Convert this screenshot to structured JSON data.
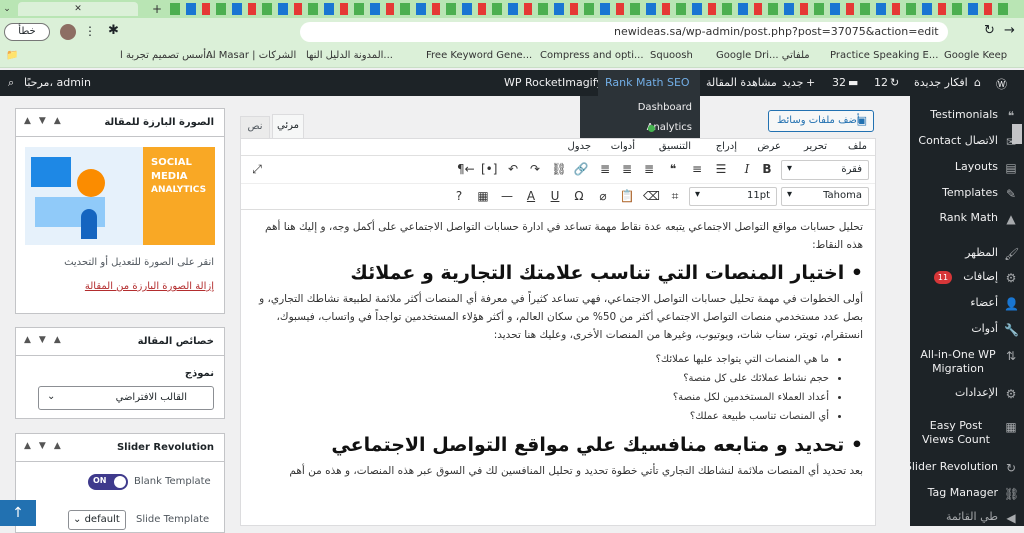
{
  "browser": {
    "url": "newideas.sa/wp-admin/post.php?post=37075&action=edit",
    "error_badge": "خطأ",
    "bookmarks": [
      "أسس تصميم تجربة ا...",
      "Al Masar | الشركات",
      "المدونة الدليل النها...",
      "Free Keyword Gene...",
      "Compress and opti...",
      "Squoosh",
      "Google Dri... ملفاتي",
      "Practice Speaking E...",
      "Google Keep"
    ]
  },
  "adminbar": {
    "greeting": "مرحبًا، admin",
    "wp_rocket": "WP Rocket",
    "imagify": "Imagify",
    "rank_math_seo": "Rank Math SEO",
    "view_post": "مشاهدة المقالة",
    "new": "جديد",
    "comments_count": "32",
    "updates_count": "12",
    "site_name": "افكار جديدة",
    "dropdown": [
      "Dashboard",
      "Analytics"
    ]
  },
  "sidebar": {
    "items": [
      "Testimonials",
      "Contact الاتصال",
      "Layouts",
      "Templates",
      "Rank Math",
      "المظهر",
      "إضافات",
      "أعضاء",
      "أدوات",
      "All-in-One WP Migration",
      "الإعدادات",
      "Easy Post Views Count",
      "Slider Revolution",
      "Tag Manager",
      "طي القائمة"
    ],
    "plugins_badge": "11"
  },
  "featured_image": {
    "title": "الصورة البارزة للمقالة",
    "img_line1": "SOCIAL",
    "img_line2": "MEDIA",
    "img_line3": "ANALYTICS",
    "edit_hint": "انقر على الصورة للتعديل أو التحديث",
    "remove_link": "إزالة الصورة البارزة من المقالة"
  },
  "post_attributes": {
    "title": "خصائص المقالة",
    "template_label": "نموذج",
    "template_value": "القالب الافتراضي"
  },
  "slider_revolution": {
    "title": "Slider Revolution",
    "toggle": "ON",
    "blank_template": "Blank Template",
    "slide_template": "Slide Template",
    "default": "default"
  },
  "editor": {
    "add_media": "أضف ملفات وسائط",
    "tab_visual": "مرئي",
    "tab_text": "نص",
    "menubar": [
      "ملف",
      "تحرير",
      "عرض",
      "إدراج",
      "التنسيق",
      "أدوات",
      "جدول"
    ],
    "format_select": "فقرة",
    "font_select": "Tahoma",
    "size_select": "11pt",
    "para1": "تحليل حسابات مواقع التواصل الاجتماعي يتبعه عدة نقاط مهمة تساعد في ادارة حسابات التواصل الاجتماعي على أكمل وجه، و إليك هنا أهم هذه النقاط:",
    "heading1": "اختيار المنصات التي تناسب علامتك التجارية و عملائك",
    "para2": "أولى الخطوات في مهمة تحليل حسابات التواصل الاجتماعي، فهي تساعد كثيراً في معرفة أي المنصات أكثر ملائمة لطبيعة نشاطك التجاري، و بصل عدد مستخدمي منصات التواصل الاجتماعي أكثر من 50% من سكان العالم، و أكثر هؤلاء المستخدمين تواجداً في واتساب، فيسبوك، انستقرام، تويتر، سناب شات، ويوتيوب، وغيرها من المنصات الأخرى، وعليك هنا تحديد:",
    "bullets": [
      "ما هي المنصات التي يتواجد عليها عملائك؟",
      "حجم نشاط عملائك على كل منصة؟",
      "أعداد العملاء المستخدمين لكل منصة؟",
      "أي المنصات تناسب طبيعة عملك؟"
    ],
    "heading2": "تحديد و متابعه منافسيك علي مواقع التواصل الاجتماعي",
    "para3": "بعد تحديد أي المنصات ملائمة لنشاطك التجاري تأتي خطوة تحديد و تحليل المنافسين لك في السوق عبر هذه المنصات، و هذه من أهم"
  }
}
